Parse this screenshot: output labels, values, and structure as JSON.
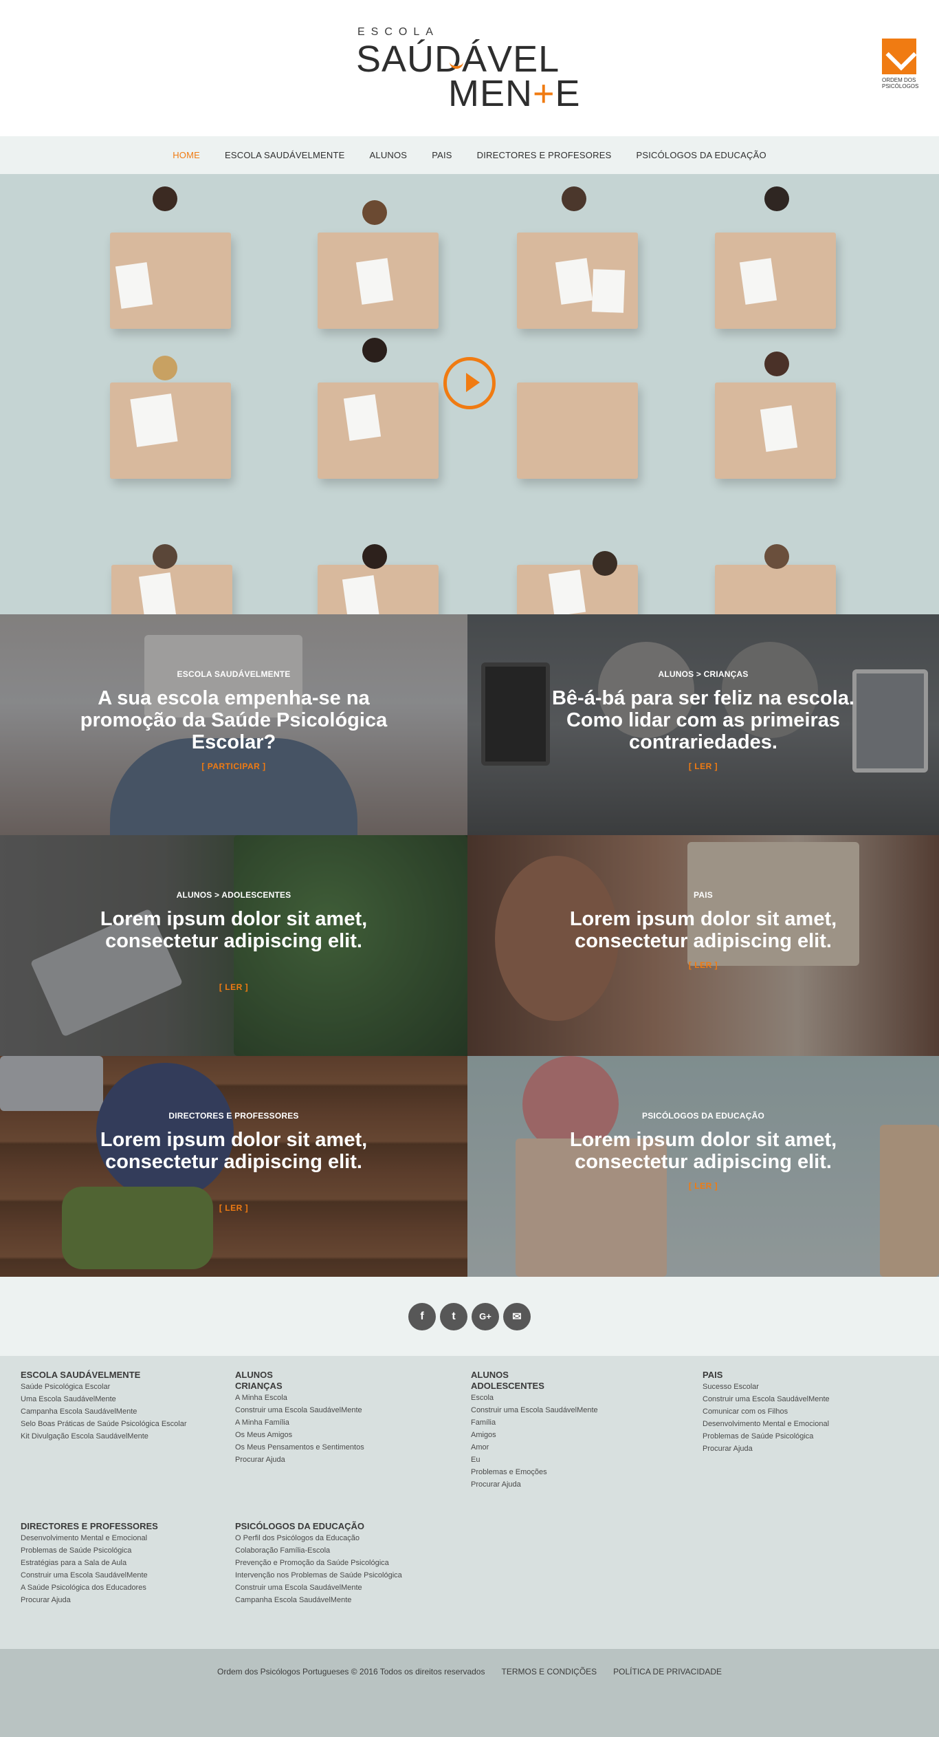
{
  "header": {
    "logo_top": "ESCOLA",
    "logo_line1": "SAÚDÁVEL",
    "logo_line2_a": "MEN",
    "logo_line2_b": "+",
    "logo_line2_c": "E",
    "partner_label": "ORDEM DOS PSICÓLOGOS"
  },
  "nav": {
    "items": [
      {
        "label": "HOME",
        "active": true
      },
      {
        "label": "ESCOLA SAUDÁVELMENTE"
      },
      {
        "label": "ALUNOS"
      },
      {
        "label": "PAIS"
      },
      {
        "label": "DIRECTORES E PROFESORES"
      },
      {
        "label": "PSICÓLOGOS DA EDUCAÇÃO"
      }
    ]
  },
  "hero": {
    "play_icon": "play-icon"
  },
  "tiles": [
    {
      "category": "ESCOLA SAUDÁVELMENTE",
      "title": "A sua escola empenha-se na promoção da Saúde Psicológica Escolar?",
      "cta": "[ PARTICIPAR ]"
    },
    {
      "category": "ALUNOS > CRIANÇAS",
      "title": "Bê-á-bá para ser feliz na escola. Como lidar com as primeiras contrariedades.",
      "cta": "[ LER ]"
    },
    {
      "category": "ALUNOS > ADOLESCENTES",
      "title": "Lorem ipsum dolor sit amet, consectetur adipiscing elit.",
      "cta": "[ LER ]"
    },
    {
      "category": "PAIS",
      "title": "Lorem ipsum dolor sit amet, consectetur adipiscing elit.",
      "cta": "[ LER ]"
    },
    {
      "category": "DIRECTORES E PROFESSORES",
      "title": "Lorem ipsum dolor sit amet, consectetur adipiscing elit.",
      "cta": "[ LER ]"
    },
    {
      "category": "PSICÓLOGOS DA EDUCAÇÃO",
      "title": "Lorem ipsum dolor sit amet, consectetur adipiscing elit.",
      "cta": "[ LER ]"
    }
  ],
  "social": [
    {
      "name": "facebook-icon",
      "glyph": "f"
    },
    {
      "name": "twitter-icon",
      "glyph": "t"
    },
    {
      "name": "google-plus-icon",
      "glyph": "G+"
    },
    {
      "name": "email-icon",
      "glyph": "✉"
    }
  ],
  "footer": {
    "col1": {
      "heading": "ESCOLA SAUDÁVELMENTE",
      "links": [
        "Saúde Psicológica Escolar",
        "Uma Escola SaudávelMente",
        "Campanha Escola SaudávelMente",
        "Selo Boas Práticas de Saúde Psicológica Escolar",
        "Kit Divulgação Escola SaudávelMente"
      ]
    },
    "col2": {
      "heading": "ALUNOS",
      "subheading": "CRIANÇAS",
      "links": [
        "A Minha Escola",
        "Construir uma Escola SaudávelMente",
        "A Minha Família",
        "Os Meus Amigos",
        "Os Meus Pensamentos e Sentimentos",
        "Procurar Ajuda"
      ]
    },
    "col3": {
      "heading": "ALUNOS",
      "subheading": "ADOLESCENTES",
      "links": [
        "Escola",
        "Construir uma Escola SaudávelMente",
        "Família",
        "Amigos",
        "Amor",
        "Eu",
        "Problemas e Emoções",
        "Procurar Ajuda"
      ]
    },
    "col4": {
      "heading": "PAIS",
      "links": [
        "Sucesso Escolar",
        "Construir uma Escola SaudávelMente",
        "Comunicar com os Filhos",
        "Desenvolvimento Mental e Emocional",
        "Problemas de Saúde Psicológica",
        "Procurar Ajuda"
      ]
    },
    "col5": {
      "heading": "DIRECTORES E PROFESSORES",
      "links": [
        "Desenvolvimento Mental e Emocional",
        "Problemas de Saúde Psicológica",
        "Estratégias para a Sala de Aula",
        "Construir uma Escola SaudávelMente",
        "A Saúde Psicológica dos Educadores",
        "Procurar Ajuda"
      ]
    },
    "col6": {
      "heading": "PSICÓLOGOS DA EDUCAÇÃO",
      "links": [
        "O Perfil dos Psicólogos da Educação",
        "Colaboração Família-Escola",
        "Prevenção e Promoção da Saúde Psicológica",
        "Intervenção nos Problemas de Saúde Psicológica",
        "Construir uma Escola SaudávelMente",
        "Campanha Escola SaudávelMente"
      ]
    }
  },
  "bottom": {
    "copyright": "Ordem dos Psicólogos Portugueses © 2016 Todos os direitos reservados",
    "terms": "TERMOS E CONDIÇÕES",
    "privacy": "POLÍTICA DE PRIVACIDADE"
  },
  "colors": {
    "accent": "#f07b12",
    "nav_bg": "#edf2f1",
    "footer_bg": "#d8e0df",
    "bottom_bg": "#b9c3c2"
  }
}
